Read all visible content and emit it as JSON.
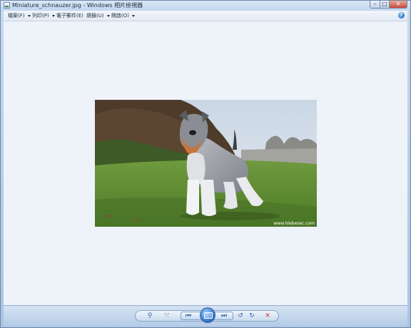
{
  "window": {
    "title": "Miniature_schnauzer.jpg - Windows 相片檢視器",
    "controls": {
      "minimize": "–",
      "maximize": "□",
      "close": "✕"
    }
  },
  "menu": {
    "items": [
      {
        "label": "檔案(F)"
      },
      {
        "label": "列印(P)"
      },
      {
        "label": "電子郵件(E)"
      },
      {
        "label": "燒錄(U)"
      },
      {
        "label": "開啟(O)"
      }
    ],
    "help": "?"
  },
  "photo": {
    "watermark": "www.hlebesec.com"
  },
  "toolbar": {
    "zoom_icon": "magnifier-icon",
    "fit_icon": "actual-size-icon",
    "prev_icon": "previous-icon",
    "slideshow_icon": "slideshow-icon",
    "next_icon": "next-icon",
    "rotate_ccw_icon": "rotate-counterclockwise-icon",
    "rotate_cw_icon": "rotate-clockwise-icon",
    "delete_icon": "delete-icon",
    "glyphs": {
      "zoom": "⚲",
      "fit": "⤧",
      "prev": "⏮",
      "next": "⏭",
      "rotate_ccw": "↺",
      "rotate_cw": "↻",
      "delete": "✕"
    }
  },
  "colors": {
    "accent": "#2a6cc3",
    "delete": "#c8362b",
    "viewer_bg": "#eef2f9"
  }
}
